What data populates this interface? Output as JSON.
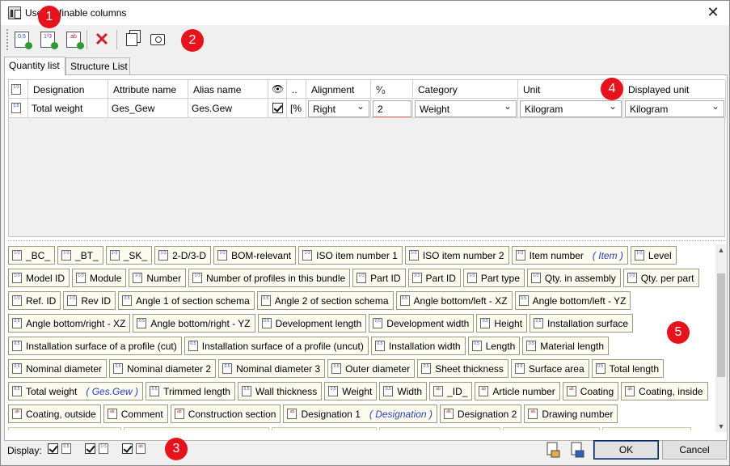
{
  "window": {
    "title": "User definable columns",
    "close_glyph": "✕"
  },
  "markers": [
    "1",
    "2",
    "3",
    "4",
    "5"
  ],
  "toolbar": {
    "buttons": [
      {
        "name": "add-quantity-column-button",
        "icon": "quantity-doc-icon",
        "label": "0.5"
      },
      {
        "name": "add-number-column-button",
        "icon": "number-doc-icon",
        "label": "1²3"
      },
      {
        "name": "add-text-column-button",
        "icon": "text-doc-icon",
        "label": "ab"
      },
      {
        "name": "delete-column-button",
        "icon": "red-x-icon",
        "label": "✕"
      },
      {
        "name": "copy-button",
        "icon": "copy-icon",
        "label": ""
      },
      {
        "name": "screenshot-button",
        "icon": "camera-icon",
        "label": ""
      }
    ]
  },
  "tabs": [
    {
      "label": "Quantity list",
      "active": true
    },
    {
      "label": "Structure List",
      "active": false
    }
  ],
  "grid": {
    "corner_icon": "1²3",
    "headers": {
      "designation": "Designation",
      "attribute": "Attribute name",
      "alias": "Alias name",
      "visible": "👁",
      "dots": "..",
      "alignment": "Alignment",
      "decimals": "⁰⁄₀",
      "category": "Category",
      "unit": "Unit",
      "displayed_unit": "Displayed unit"
    },
    "row": {
      "row_icon": "0.5",
      "designation": "Total weight",
      "attribute": "Ges_Gew",
      "alias": "Ges.Gew",
      "visible": true,
      "dots": "[%",
      "alignment": "Right",
      "decimals": "2",
      "category": "Weight",
      "unit": "Kilogram",
      "displayed_unit": "Kilogram"
    }
  },
  "chips": [
    [
      {
        "label": "_BC_",
        "icon": "1²3"
      },
      {
        "label": "_BT_",
        "icon": "1²3"
      },
      {
        "label": "_SK_",
        "icon": "1²3"
      },
      {
        "label": "2-D/3-D",
        "icon": "1²3"
      },
      {
        "label": "BOM-relevant",
        "icon": "1²3"
      },
      {
        "label": "ISO item number 1",
        "icon": "1²3"
      },
      {
        "label": "ISO item number 2",
        "icon": "1²3"
      },
      {
        "label": "Item number",
        "icon": "1²3",
        "alias": "( Item )"
      },
      {
        "label": "Level",
        "icon": "1²3"
      }
    ],
    [
      {
        "label": "Model ID",
        "icon": "1²3"
      },
      {
        "label": "Module",
        "icon": "1²3"
      },
      {
        "label": "Number",
        "icon": "1²3"
      },
      {
        "label": "Number of profiles in this bundle",
        "icon": "1²3"
      },
      {
        "label": "Part ID",
        "icon": "1²3"
      },
      {
        "label": "Part ID",
        "icon": "1²3"
      },
      {
        "label": "Part type",
        "icon": "1²3"
      },
      {
        "label": "Qty. in assembly",
        "icon": "1²3"
      },
      {
        "label": "Qty. per part",
        "icon": "1²3"
      }
    ],
    [
      {
        "label": "Ref. ID",
        "icon": "1²3"
      },
      {
        "label": "Rev ID",
        "icon": "1²3"
      },
      {
        "label": "Angle 1 of section schema",
        "icon": "0.5"
      },
      {
        "label": "Angle 2 of section schema",
        "icon": "0.5"
      },
      {
        "label": "Angle bottom/left - XZ",
        "icon": "0.5"
      },
      {
        "label": "Angle bottom/left - YZ",
        "icon": "0.5"
      }
    ],
    [
      {
        "label": "Angle bottom/right - XZ",
        "icon": "0.5"
      },
      {
        "label": "Angle bottom/right - YZ",
        "icon": "0.5"
      },
      {
        "label": "Development length",
        "icon": "0.5"
      },
      {
        "label": "Development width",
        "icon": "0.5"
      },
      {
        "label": "Height",
        "icon": "0.5"
      },
      {
        "label": "Installation surface",
        "icon": "0.5"
      }
    ],
    [
      {
        "label": "Installation surface of a profile (cut)",
        "icon": "0.5"
      },
      {
        "label": "Installation surface of a profile (uncut)",
        "icon": "0.5"
      },
      {
        "label": "Installation width",
        "icon": "0.5"
      },
      {
        "label": "Length",
        "icon": "0.5"
      },
      {
        "label": "Material length",
        "icon": "0.5"
      }
    ],
    [
      {
        "label": "Nominal diameter",
        "icon": "0.5"
      },
      {
        "label": "Nominal diameter 2",
        "icon": "0.5"
      },
      {
        "label": "Nominal diameter 3",
        "icon": "0.5"
      },
      {
        "label": "Outer diameter",
        "icon": "0.5"
      },
      {
        "label": "Sheet thickness",
        "icon": "0.5"
      },
      {
        "label": "Surface area",
        "icon": "0.5"
      },
      {
        "label": "Total length",
        "icon": "0.5"
      }
    ],
    [
      {
        "label": "Total weight",
        "icon": "0.5",
        "alias": "( Ges.Gew )"
      },
      {
        "label": "Trimmed length",
        "icon": "0.5"
      },
      {
        "label": "Wall thickness",
        "icon": "0.5"
      },
      {
        "label": "Weight",
        "icon": "0.5"
      },
      {
        "label": "Width",
        "icon": "0.5"
      },
      {
        "label": "_ID_",
        "icon": "ab"
      },
      {
        "label": "Article number",
        "icon": "ab"
      },
      {
        "label": "Coating",
        "icon": "ab"
      },
      {
        "label": "Coating, inside",
        "icon": "ab"
      }
    ],
    [
      {
        "label": "Coating, outside",
        "icon": "ab"
      },
      {
        "label": "Comment",
        "icon": "ab"
      },
      {
        "label": "Construction section",
        "icon": "ab"
      },
      {
        "label": "Designation 1",
        "icon": "ab",
        "alias": "( Designation )"
      },
      {
        "label": "Designation 2",
        "icon": "ab"
      },
      {
        "label": "Drawing number",
        "icon": "ab"
      }
    ]
  ],
  "display": {
    "label": "Display:",
    "filters": [
      {
        "icon": "0.5",
        "checked": true
      },
      {
        "icon": "1²3",
        "checked": true
      },
      {
        "icon": "ab",
        "checked": true
      }
    ]
  },
  "buttons": {
    "ok": "OK",
    "cancel": "Cancel"
  }
}
